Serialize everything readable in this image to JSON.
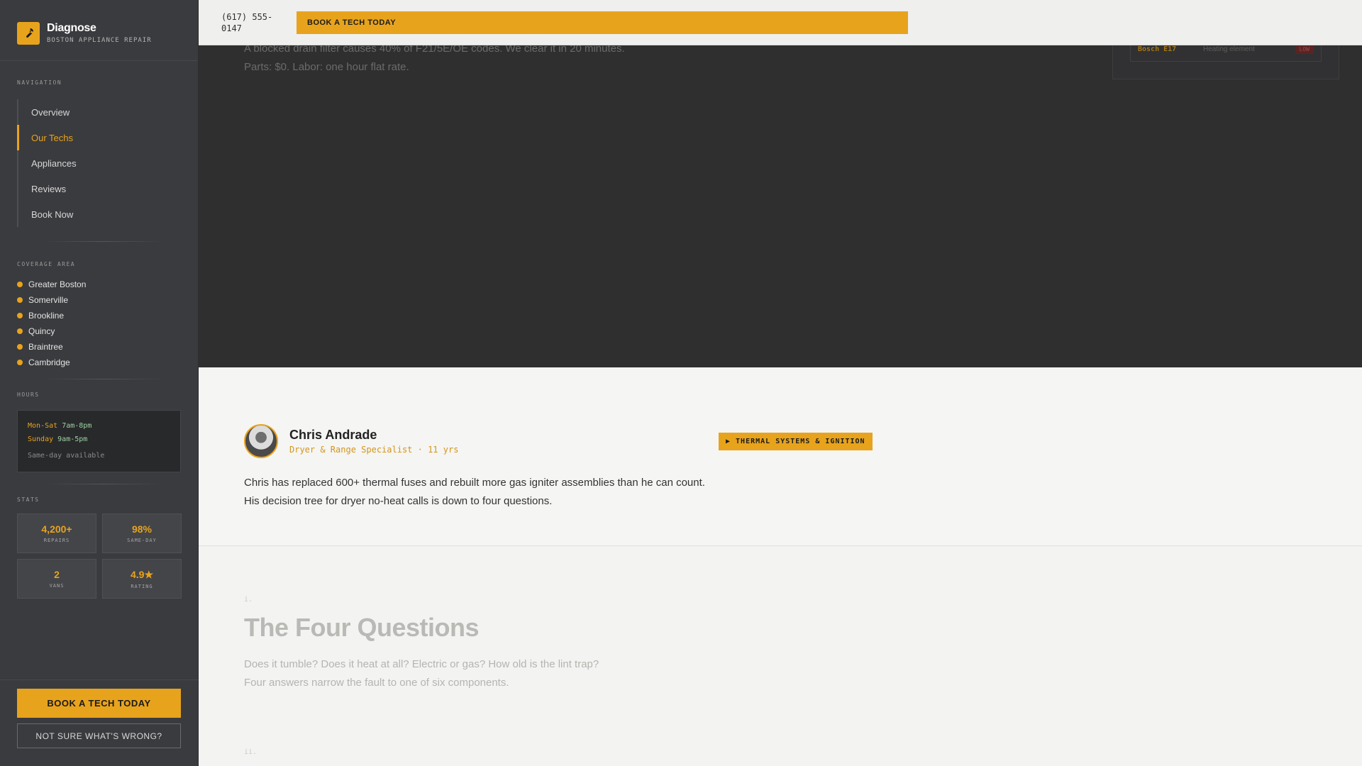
{
  "brand": {
    "name": "Diagnose",
    "subtitle": "BOSTON APPLIANCE REPAIR",
    "logo_icon": "wrench-icon"
  },
  "navigation": {
    "label": "NAVIGATION",
    "items": [
      {
        "label": "Overview",
        "active": false
      },
      {
        "label": "Our Techs",
        "active": true
      },
      {
        "label": "Appliances",
        "active": false
      },
      {
        "label": "Reviews",
        "active": false
      },
      {
        "label": "Book Now",
        "active": false
      }
    ]
  },
  "coverage": {
    "label": "COVERAGE AREA",
    "areas": [
      "Greater Boston",
      "Somerville",
      "Brookline",
      "Quincy",
      "Braintree",
      "Cambridge"
    ]
  },
  "hours": {
    "label": "HOURS",
    "rows": [
      {
        "day": "Mon-Sat",
        "time": "7am-8pm"
      },
      {
        "day": "Sunday",
        "time": "9am-5pm"
      }
    ],
    "note": "Same-day available"
  },
  "stats": {
    "label": "STATS",
    "items": [
      {
        "value": "4,200+",
        "label": "REPAIRS"
      },
      {
        "value": "98%",
        "label": "SAME-DAY"
      },
      {
        "value": "2",
        "label": "VANS"
      },
      {
        "value": "4.9★",
        "label": "RATING"
      }
    ]
  },
  "sidebar_actions": {
    "book_label": "BOOK A TECH TODAY",
    "help_label": "NOT SURE WHAT'S WRONG?"
  },
  "topbar": {
    "phone": "(617) 555-0147",
    "book_label": "BOOK A TECH TODAY"
  },
  "previous_section": {
    "paragraph": "A blocked drain filter causes 40% of F21/5E/OE codes. We clear it in 20 minutes. Parts: $0. Labor: one hour flat rate.",
    "side_card_row": {
      "code": "Bosch E17",
      "part": "Heating element",
      "badge": "LOW"
    }
  },
  "tech": {
    "name": "Chris Andrade",
    "role": "Dryer & Range Specialist · 11 yrs",
    "specialty": "▶ THERMAL SYSTEMS & IGNITION",
    "bio": "Chris has replaced 600+ thermal fuses and rebuilt more gas igniter assemblies than he can count. His decision tree for dryer no-heat calls is down to four questions."
  },
  "questions_section": {
    "number": "i.",
    "next_number": "ii.",
    "title": "The Four Questions",
    "paragraph": "Does it tumble? Does it heat at all? Electric or gas? How old is the lint trap? Four answers narrow the fault to one of six components."
  },
  "colors": {
    "accent": "#e8a31d",
    "sidebar_bg": "#3a3b3e",
    "dark_section": "#2f2f30",
    "light_bg": "#f3f3f1"
  }
}
